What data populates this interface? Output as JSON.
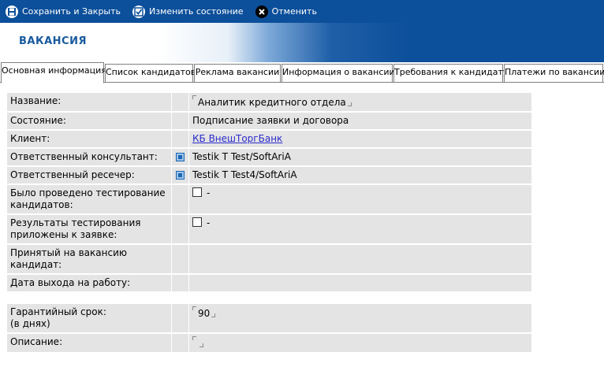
{
  "toolbar": {
    "save_close": "Сохранить и Закрыть",
    "change_state": "Изменить состояние",
    "cancel": "Отменить"
  },
  "page": {
    "title": "ВАКАНСИЯ"
  },
  "tabs": [
    {
      "label": "Основная информация",
      "active": true
    },
    {
      "label": "Список кандидатов"
    },
    {
      "label": "Реклама вакансии"
    },
    {
      "label": "Информация о вакансии"
    },
    {
      "label": "Требования к кандидату"
    },
    {
      "label": "Платежи по вакансии"
    }
  ],
  "form": {
    "name_label": "Название:",
    "name_value": "Аналитик кредитного отдела",
    "state_label": "Состояние:",
    "state_value": "Подписание заявки и договора",
    "client_label": "Клиент:",
    "client_value": "КБ ВнешТоргБанк",
    "consultant_label": "Ответственный консультант:",
    "consultant_value": "Testik T Test/SoftAriA",
    "researcher_label": "Ответственный ресечер:",
    "researcher_value": "Testik T Test4/SoftAriA",
    "testing_done_label": "Было проведено тестирование кандидатов:",
    "testing_done_value": "-",
    "testing_attached_label": "Результаты тестирования приложены к заявке:",
    "testing_attached_value": "-",
    "accepted_candidate_label": "Принятый на вакансию кандидат:",
    "start_date_label": "Дата выхода на работу:",
    "warranty_label_1": "Гарантийный срок:",
    "warranty_label_2": "(в днях)",
    "warranty_value": "90",
    "description_label": "Описание:",
    "description_value": ""
  }
}
